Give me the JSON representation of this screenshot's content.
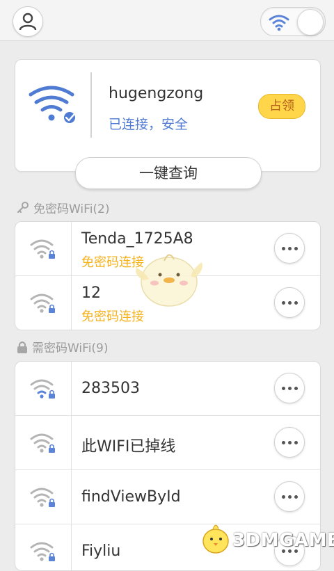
{
  "connected": {
    "ssid": "hugengzong",
    "status": "已连接，安全",
    "occupy_label": "占领",
    "query_label": "一键查询"
  },
  "free_section": {
    "title": "免密码WiFi(2)",
    "networks": [
      {
        "name": "Tenda_1725A8",
        "sub": "免密码连接"
      },
      {
        "name": "12",
        "sub": "免密码连接"
      }
    ]
  },
  "secured_section": {
    "title": "需密码WiFi(9)",
    "networks": [
      {
        "name": "283503"
      },
      {
        "name": "此WIFI已掉线"
      },
      {
        "name": "findViewById"
      },
      {
        "name": "Fiyliu"
      }
    ]
  },
  "watermark": "3DMGAME",
  "colors": {
    "accent_blue": "#4f7bd3",
    "free_orange": "#f5b21d",
    "occupy_yellow": "#ffd54a",
    "wifi_gray": "#b4b4b4"
  }
}
